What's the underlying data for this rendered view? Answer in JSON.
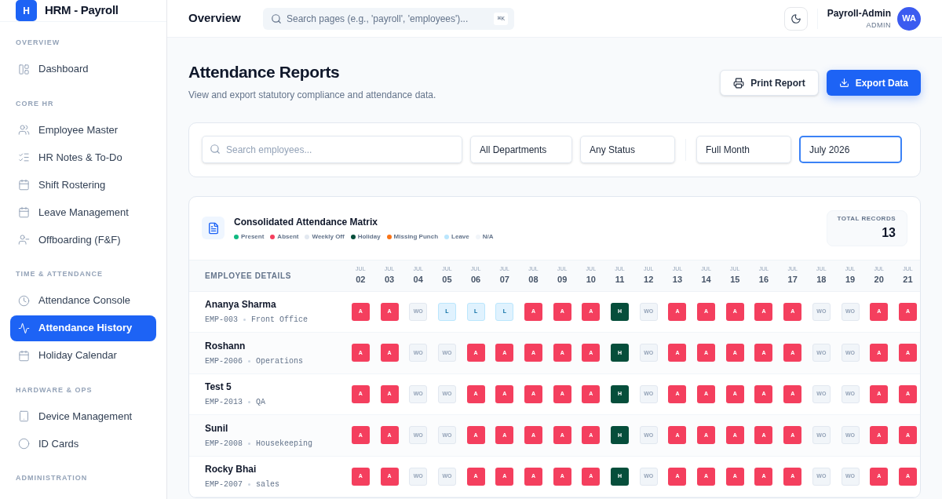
{
  "brand": {
    "logo": "H",
    "name": "HRM - Payroll"
  },
  "sidebar": {
    "sections": [
      {
        "heading": "OVERVIEW",
        "items": [
          {
            "label": "Dashboard",
            "kind": "layout",
            "selected": false
          }
        ]
      },
      {
        "heading": "CORE HR",
        "items": [
          {
            "label": "Employee Master",
            "kind": "users",
            "selected": false
          },
          {
            "label": "HR Notes & To-Do",
            "kind": "list",
            "selected": false
          },
          {
            "label": "Shift Rostering",
            "kind": "calendar",
            "selected": false
          },
          {
            "label": "Leave Management",
            "kind": "calendar",
            "selected": false
          },
          {
            "label": "Offboarding (F&F)",
            "kind": "user-minus",
            "selected": false
          }
        ]
      },
      {
        "heading": "TIME & ATTENDANCE",
        "items": [
          {
            "label": "Attendance Console",
            "kind": "clock",
            "selected": false
          },
          {
            "label": "Attendance History",
            "kind": "activity",
            "selected": true
          },
          {
            "label": "Holiday Calendar",
            "kind": "calendar",
            "selected": false
          }
        ]
      },
      {
        "heading": "HARDWARE & OPS",
        "items": [
          {
            "label": "Device Management",
            "kind": "tablet",
            "selected": false
          },
          {
            "label": "ID Cards",
            "kind": "circle",
            "selected": false
          }
        ]
      },
      {
        "heading": "ADMINISTRATION"
      }
    ]
  },
  "topbar": {
    "title": "Overview",
    "search": {
      "placeholder": "Search pages (e.g., 'payroll', 'employees')...",
      "shortcut": "⌘K"
    },
    "user": {
      "name": "Payroll-Admin",
      "role": "ADMIN",
      "initials": "WA"
    }
  },
  "page": {
    "title": "Attendance Reports",
    "subtitle": "View and export statutory compliance and attendance data.",
    "actions": [
      {
        "label": "Print Report",
        "kind": "secondary"
      },
      {
        "label": "Export Data",
        "kind": "primary"
      }
    ]
  },
  "filters": {
    "search": {
      "placeholder": "Search employees..."
    },
    "selects": [
      {
        "value": "All Departments",
        "selected": false
      },
      {
        "value": "Any Status",
        "selected": false
      },
      {
        "value": "Full Month",
        "selected": false
      },
      {
        "value": "July 2026",
        "selected": true
      }
    ]
  },
  "matrix": {
    "title": "Consolidated Attendance Matrix",
    "legend": [
      {
        "label": "Present",
        "color": "#10b981"
      },
      {
        "label": "Absent",
        "color": "#f43f5e"
      },
      {
        "label": "Weekly Off",
        "color": "#e2e8f0"
      },
      {
        "label": "Holiday",
        "color": "#064e3b"
      },
      {
        "label": "Missing Punch",
        "color": "#f97316"
      },
      {
        "label": "Leave",
        "color": "#bae6fd"
      },
      {
        "label": "N/A",
        "color": "#f1f5f9"
      }
    ],
    "total": {
      "label": "TOTAL RECORDS",
      "value": "13"
    },
    "employee_header": "EMPLOYEE DETAILS",
    "days": [
      {
        "month": "JUL",
        "day": "02"
      },
      {
        "month": "JUL",
        "day": "03"
      },
      {
        "month": "JUL",
        "day": "04"
      },
      {
        "month": "JUL",
        "day": "05"
      },
      {
        "month": "JUL",
        "day": "06"
      },
      {
        "month": "JUL",
        "day": "07"
      },
      {
        "month": "JUL",
        "day": "08"
      },
      {
        "month": "JUL",
        "day": "09"
      },
      {
        "month": "JUL",
        "day": "10"
      },
      {
        "month": "JUL",
        "day": "11"
      },
      {
        "month": "JUL",
        "day": "12"
      },
      {
        "month": "JUL",
        "day": "13"
      },
      {
        "month": "JUL",
        "day": "14"
      },
      {
        "month": "JUL",
        "day": "15"
      },
      {
        "month": "JUL",
        "day": "16"
      },
      {
        "month": "JUL",
        "day": "17"
      },
      {
        "month": "JUL",
        "day": "18"
      },
      {
        "month": "JUL",
        "day": "19"
      },
      {
        "month": "JUL",
        "day": "20"
      },
      {
        "month": "JUL",
        "day": "21"
      }
    ],
    "rows": [
      {
        "name": "Ananya Sharma",
        "id": "EMP-003",
        "department": "Front Office",
        "cells": [
          {
            "text": "A",
            "kind": "absent"
          },
          {
            "text": "A",
            "kind": "absent"
          },
          {
            "text": "WO",
            "kind": "off"
          },
          {
            "text": "L",
            "kind": "leave"
          },
          {
            "text": "L",
            "kind": "leave"
          },
          {
            "text": "L",
            "kind": "leave"
          },
          {
            "text": "A",
            "kind": "absent"
          },
          {
            "text": "A",
            "kind": "absent"
          },
          {
            "text": "A",
            "kind": "absent"
          },
          {
            "text": "H",
            "kind": "holiday"
          },
          {
            "text": "WO",
            "kind": "off"
          },
          {
            "text": "A",
            "kind": "absent"
          },
          {
            "text": "A",
            "kind": "absent"
          },
          {
            "text": "A",
            "kind": "absent"
          },
          {
            "text": "A",
            "kind": "absent"
          },
          {
            "text": "A",
            "kind": "absent"
          },
          {
            "text": "WO",
            "kind": "off"
          },
          {
            "text": "WO",
            "kind": "off"
          },
          {
            "text": "A",
            "kind": "absent"
          },
          {
            "text": "A",
            "kind": "absent"
          }
        ]
      },
      {
        "name": "Roshann",
        "id": "EMP-2006",
        "department": "Operations",
        "cells": [
          {
            "text": "A",
            "kind": "absent"
          },
          {
            "text": "A",
            "kind": "absent"
          },
          {
            "text": "WO",
            "kind": "off"
          },
          {
            "text": "WO",
            "kind": "off"
          },
          {
            "text": "A",
            "kind": "absent"
          },
          {
            "text": "A",
            "kind": "absent"
          },
          {
            "text": "A",
            "kind": "absent"
          },
          {
            "text": "A",
            "kind": "absent"
          },
          {
            "text": "A",
            "kind": "absent"
          },
          {
            "text": "H",
            "kind": "holiday"
          },
          {
            "text": "WO",
            "kind": "off"
          },
          {
            "text": "A",
            "kind": "absent"
          },
          {
            "text": "A",
            "kind": "absent"
          },
          {
            "text": "A",
            "kind": "absent"
          },
          {
            "text": "A",
            "kind": "absent"
          },
          {
            "text": "A",
            "kind": "absent"
          },
          {
            "text": "WO",
            "kind": "off"
          },
          {
            "text": "WO",
            "kind": "off"
          },
          {
            "text": "A",
            "kind": "absent"
          },
          {
            "text": "A",
            "kind": "absent"
          }
        ]
      },
      {
        "name": "Test 5",
        "id": "EMP-2013",
        "department": "QA",
        "cells": [
          {
            "text": "A",
            "kind": "absent"
          },
          {
            "text": "A",
            "kind": "absent"
          },
          {
            "text": "WO",
            "kind": "off"
          },
          {
            "text": "WO",
            "kind": "off"
          },
          {
            "text": "A",
            "kind": "absent"
          },
          {
            "text": "A",
            "kind": "absent"
          },
          {
            "text": "A",
            "kind": "absent"
          },
          {
            "text": "A",
            "kind": "absent"
          },
          {
            "text": "A",
            "kind": "absent"
          },
          {
            "text": "H",
            "kind": "holiday"
          },
          {
            "text": "WO",
            "kind": "off"
          },
          {
            "text": "A",
            "kind": "absent"
          },
          {
            "text": "A",
            "kind": "absent"
          },
          {
            "text": "A",
            "kind": "absent"
          },
          {
            "text": "A",
            "kind": "absent"
          },
          {
            "text": "A",
            "kind": "absent"
          },
          {
            "text": "WO",
            "kind": "off"
          },
          {
            "text": "WO",
            "kind": "off"
          },
          {
            "text": "A",
            "kind": "absent"
          },
          {
            "text": "A",
            "kind": "absent"
          }
        ]
      },
      {
        "name": "Sunil",
        "id": "EMP-2008",
        "department": "Housekeeping",
        "cells": [
          {
            "text": "A",
            "kind": "absent"
          },
          {
            "text": "A",
            "kind": "absent"
          },
          {
            "text": "WO",
            "kind": "off"
          },
          {
            "text": "WO",
            "kind": "off"
          },
          {
            "text": "A",
            "kind": "absent"
          },
          {
            "text": "A",
            "kind": "absent"
          },
          {
            "text": "A",
            "kind": "absent"
          },
          {
            "text": "A",
            "kind": "absent"
          },
          {
            "text": "A",
            "kind": "absent"
          },
          {
            "text": "H",
            "kind": "holiday"
          },
          {
            "text": "WO",
            "kind": "off"
          },
          {
            "text": "A",
            "kind": "absent"
          },
          {
            "text": "A",
            "kind": "absent"
          },
          {
            "text": "A",
            "kind": "absent"
          },
          {
            "text": "A",
            "kind": "absent"
          },
          {
            "text": "A",
            "kind": "absent"
          },
          {
            "text": "WO",
            "kind": "off"
          },
          {
            "text": "WO",
            "kind": "off"
          },
          {
            "text": "A",
            "kind": "absent"
          },
          {
            "text": "A",
            "kind": "absent"
          }
        ]
      },
      {
        "name": "Rocky Bhai",
        "id": "EMP-2007",
        "department": "sales",
        "cells": [
          {
            "text": "A",
            "kind": "absent"
          },
          {
            "text": "A",
            "kind": "absent"
          },
          {
            "text": "WO",
            "kind": "off"
          },
          {
            "text": "WO",
            "kind": "off"
          },
          {
            "text": "A",
            "kind": "absent"
          },
          {
            "text": "A",
            "kind": "absent"
          },
          {
            "text": "A",
            "kind": "absent"
          },
          {
            "text": "A",
            "kind": "absent"
          },
          {
            "text": "A",
            "kind": "absent"
          },
          {
            "text": "H",
            "kind": "holiday"
          },
          {
            "text": "WO",
            "kind": "off"
          },
          {
            "text": "A",
            "kind": "absent"
          },
          {
            "text": "A",
            "kind": "absent"
          },
          {
            "text": "A",
            "kind": "absent"
          },
          {
            "text": "A",
            "kind": "absent"
          },
          {
            "text": "A",
            "kind": "absent"
          },
          {
            "text": "WO",
            "kind": "off"
          },
          {
            "text": "WO",
            "kind": "off"
          },
          {
            "text": "A",
            "kind": "absent"
          },
          {
            "text": "A",
            "kind": "absent"
          }
        ]
      }
    ]
  }
}
